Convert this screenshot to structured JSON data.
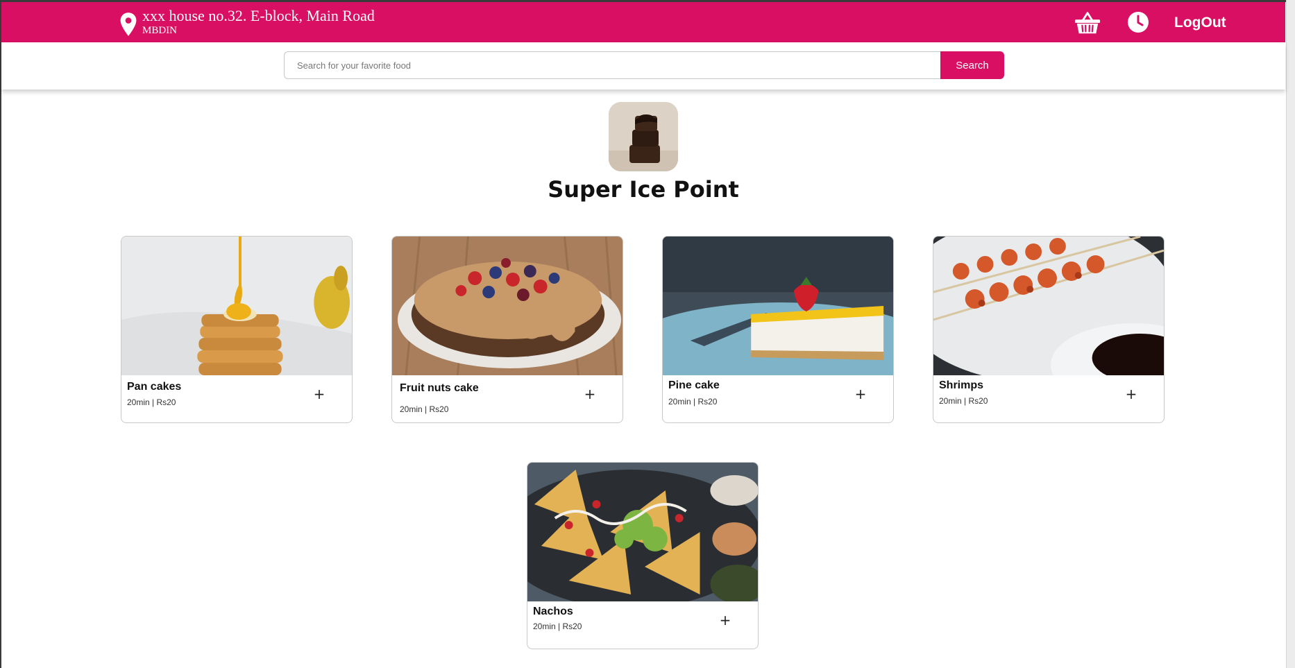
{
  "header": {
    "address_line1": "xxx house no.32. E-block, Main Road",
    "address_line2": "MBDIN",
    "logout_label": "LogOut",
    "brand_color": "#d90f63",
    "icons": [
      "location-pin-icon",
      "basket-icon",
      "clock-icon"
    ]
  },
  "search": {
    "placeholder": "Search for your favorite food",
    "button_label": "Search"
  },
  "store": {
    "name": "Super Ice Point"
  },
  "items": [
    {
      "name": "Pan cakes",
      "meta": "20min | Rs20",
      "add_label": "+"
    },
    {
      "name": "Fruit nuts cake",
      "meta": "20min | Rs20",
      "add_label": "+"
    },
    {
      "name": "Pine cake",
      "meta": "20min | Rs20",
      "add_label": "+"
    },
    {
      "name": "Shrimps",
      "meta": "20min | Rs20",
      "add_label": "+"
    },
    {
      "name": "Nachos",
      "meta": "20min | Rs20",
      "add_label": "+"
    }
  ]
}
